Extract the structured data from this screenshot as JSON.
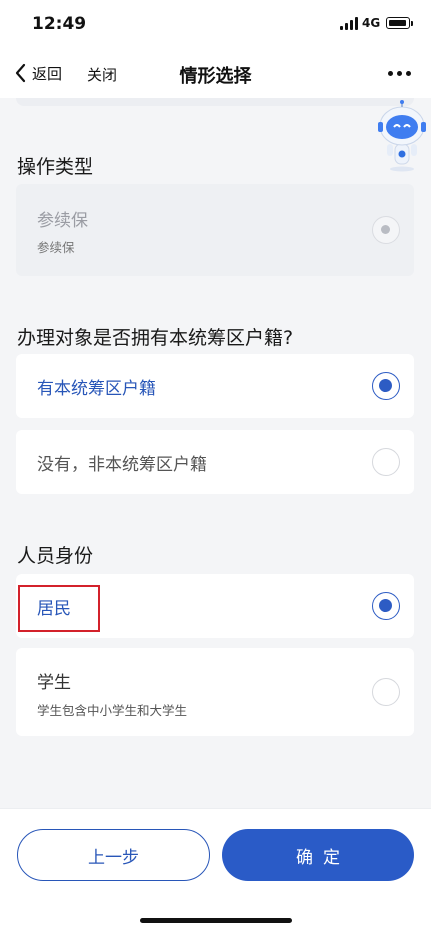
{
  "status_bar": {
    "time": "12:49",
    "network": "4G"
  },
  "nav": {
    "back_label": "返回",
    "close_label": "关闭",
    "title": "情形选择"
  },
  "sections": {
    "operation_type": {
      "title": "操作类型",
      "option": {
        "title": "参续保",
        "subtitle": "参续保",
        "state": "disabled-selected"
      }
    },
    "household": {
      "title": "办理对象是否拥有本统筹区户籍?",
      "options": [
        {
          "title": "有本统筹区户籍",
          "selected": true
        },
        {
          "title": "没有，非本统筹区户籍",
          "selected": false
        }
      ]
    },
    "identity": {
      "title": "人员身份",
      "options": [
        {
          "title": "居民",
          "selected": true
        },
        {
          "title": "学生",
          "subtitle": "学生包含中小学生和大学生",
          "selected": false
        }
      ]
    }
  },
  "footer": {
    "prev_label": "上一步",
    "confirm_label": "确定"
  },
  "colors": {
    "accent": "#2a5bc7",
    "highlight": "#d3212b"
  }
}
